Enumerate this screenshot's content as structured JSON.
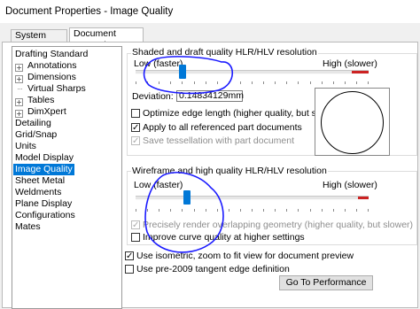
{
  "window": {
    "title": "Document Properties - Image Quality"
  },
  "tabs": [
    {
      "label": "System Options",
      "active": false
    },
    {
      "label": "Document Properties",
      "active": true
    }
  ],
  "tree": {
    "items": [
      {
        "label": "Drafting Standard",
        "selected": false,
        "expander": ""
      },
      {
        "label": "Annotations",
        "selected": false,
        "expander": "+"
      },
      {
        "label": "Dimensions",
        "selected": false,
        "expander": "+"
      },
      {
        "label": "Virtual Sharps",
        "selected": false,
        "expander": ""
      },
      {
        "label": "Tables",
        "selected": false,
        "expander": "+"
      },
      {
        "label": "DimXpert",
        "selected": false,
        "expander": "+"
      },
      {
        "label": "Detailing",
        "selected": false,
        "expander": ""
      },
      {
        "label": "Grid/Snap",
        "selected": false,
        "expander": ""
      },
      {
        "label": "Units",
        "selected": false,
        "expander": ""
      },
      {
        "label": "Model Display",
        "selected": false,
        "expander": ""
      },
      {
        "label": "Image Quality",
        "selected": true,
        "expander": ""
      },
      {
        "label": "Sheet Metal",
        "selected": false,
        "expander": ""
      },
      {
        "label": "Weldments",
        "selected": false,
        "expander": ""
      },
      {
        "label": "Plane Display",
        "selected": false,
        "expander": ""
      },
      {
        "label": "Configurations",
        "selected": false,
        "expander": ""
      },
      {
        "label": "Mates",
        "selected": false,
        "expander": ""
      }
    ]
  },
  "shaded": {
    "title": "Shaded and draft quality HLR/HLV resolution",
    "low_label": "Low (faster)",
    "high_label": "High (slower)",
    "slider_value": 0.2,
    "deviation_label": "Deviation:",
    "deviation_value": "0.14834129mm",
    "options": [
      {
        "label": "Optimize edge length (higher quality, but slower)",
        "checked": false,
        "enabled": true
      },
      {
        "label": "Apply to all referenced part documents",
        "checked": true,
        "enabled": true
      },
      {
        "label": "Save tessellation with part document",
        "checked": true,
        "enabled": false
      }
    ]
  },
  "wireframe": {
    "title": "Wireframe and high quality HLR/HLV resolution",
    "low_label": "Low (faster)",
    "high_label": "High (slower)",
    "slider_value": 0.22,
    "options": [
      {
        "label": "Precisely render overlapping geometry (higher quality, but slower)",
        "checked": true,
        "enabled": false
      },
      {
        "label": "Improve curve quality at higher settings",
        "checked": false,
        "enabled": true
      }
    ]
  },
  "bottom": {
    "options": [
      {
        "label": "Use isometric, zoom to fit view for document preview",
        "checked": true,
        "enabled": true
      },
      {
        "label": "Use pre-2009 tangent edge definition",
        "checked": false,
        "enabled": true
      }
    ],
    "button_label": "Go To Performance"
  },
  "colors": {
    "accent": "#0078d7",
    "slider_red": "#cc2222",
    "annotation": "#1a1aff"
  },
  "check_glyph": "✓"
}
